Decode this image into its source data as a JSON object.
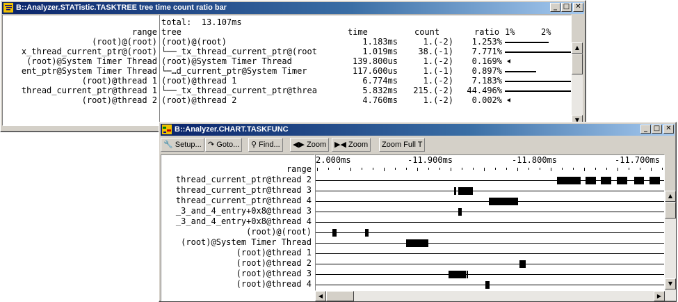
{
  "stat_window": {
    "title": "B::Analyzer.STATistic.TASKTREE tree time count ratio bar",
    "total": "total:  13.107ms",
    "headers": {
      "range": "range",
      "tree": "tree",
      "time": "time",
      "count": "count",
      "ratio": "ratio",
      "p1": "1%",
      "p2": "2%"
    },
    "rows": [
      {
        "range": "(root)@(root)",
        "tree": "(root)@(root)",
        "time": "1.183ms",
        "count": "1.(-2)",
        "ratio": "1.253%",
        "bar": 1.253
      },
      {
        "range": "x_thread_current_ptr@(root)",
        "tree": "└──_tx_thread_current_ptr@(root",
        "time": "1.019ms",
        "count": "38.(-1)",
        "ratio": "7.771%",
        "bar": 7.771
      },
      {
        "range": "(root)@System Timer Thread",
        "tree": "(root)@System Timer Thread",
        "time": "139.800us",
        "count": "1.(-2)",
        "ratio": "0.169%",
        "bar": 0.169
      },
      {
        "range": "ent_ptr@System Timer Thread",
        "tree": "└─…d_current_ptr@System Timer",
        "time": "117.600us",
        "count": "1.(-1)",
        "ratio": "0.897%",
        "bar": 0.897
      },
      {
        "range": "(root)@thread 1",
        "tree": "(root)@thread 1",
        "time": "6.774ms",
        "count": "1.(-2)",
        "ratio": "7.183%",
        "bar": 7.183
      },
      {
        "range": "thread_current_ptr@thread 1",
        "tree": "└──_tx_thread_current_ptr@threa",
        "time": "5.832ms",
        "count": "215.(-2)",
        "ratio": "44.496%",
        "bar": 44.496
      },
      {
        "range": "(root)@thread 2",
        "tree": "(root)@thread 2",
        "time": "4.760ms",
        "count": "1.(-2)",
        "ratio": "0.002%",
        "bar": 0.002
      }
    ]
  },
  "chart_window": {
    "title": "B::Analyzer.CHART.TASKFUNC",
    "toolbar": {
      "setup": "Setup...",
      "goto": "Goto...",
      "find": "Find...",
      "zoom_in": "Zoom",
      "zoom_out": "Zoom",
      "zoom_full": "Zoom Full T"
    },
    "range_label": "range",
    "time_labels": [
      "2.000ms",
      "-11.900ms",
      "-11.800ms",
      "-11.700ms"
    ],
    "rows": [
      {
        "label": "thread_current_ptr@thread 2",
        "segments": [
          [
            -11.783,
            -11.759
          ],
          [
            -11.754,
            -11.743
          ],
          [
            -11.738,
            -11.727
          ],
          [
            -11.721,
            -11.71
          ],
          [
            -11.703,
            -11.693
          ],
          [
            -11.687,
            -11.676
          ]
        ]
      },
      {
        "label": "thread_current_ptr@thread 3",
        "segments": [
          [
            -11.89,
            -11.888
          ],
          [
            -11.886,
            -11.871
          ]
        ]
      },
      {
        "label": "thread_current_ptr@thread 4",
        "segments": [
          [
            -11.854,
            -11.824
          ]
        ]
      },
      {
        "label": "_3_and_4_entry+0x8@thread 3",
        "segments": [
          [
            -11.886,
            -11.882
          ]
        ]
      },
      {
        "label": "_3_and_4_entry+0x8@thread 4",
        "segments": []
      },
      {
        "label": "(root)@(root)",
        "segments": [
          [
            -12.017,
            -12.012
          ],
          [
            -11.983,
            -11.979
          ]
        ]
      },
      {
        "label": "(root)@System Timer Thread",
        "segments": [
          [
            -11.94,
            -11.917
          ]
        ]
      },
      {
        "label": "(root)@thread 1",
        "segments": []
      },
      {
        "label": "(root)@thread 2",
        "segments": [
          [
            -11.822,
            -11.816
          ]
        ]
      },
      {
        "label": "(root)@thread 3",
        "segments": [
          [
            -11.896,
            -11.878
          ],
          [
            -11.877,
            -11.876
          ]
        ]
      },
      {
        "label": "(root)@thread 4",
        "segments": [
          [
            -11.858,
            -11.853
          ]
        ]
      }
    ],
    "x_range": [
      -12.034,
      -11.672
    ]
  }
}
